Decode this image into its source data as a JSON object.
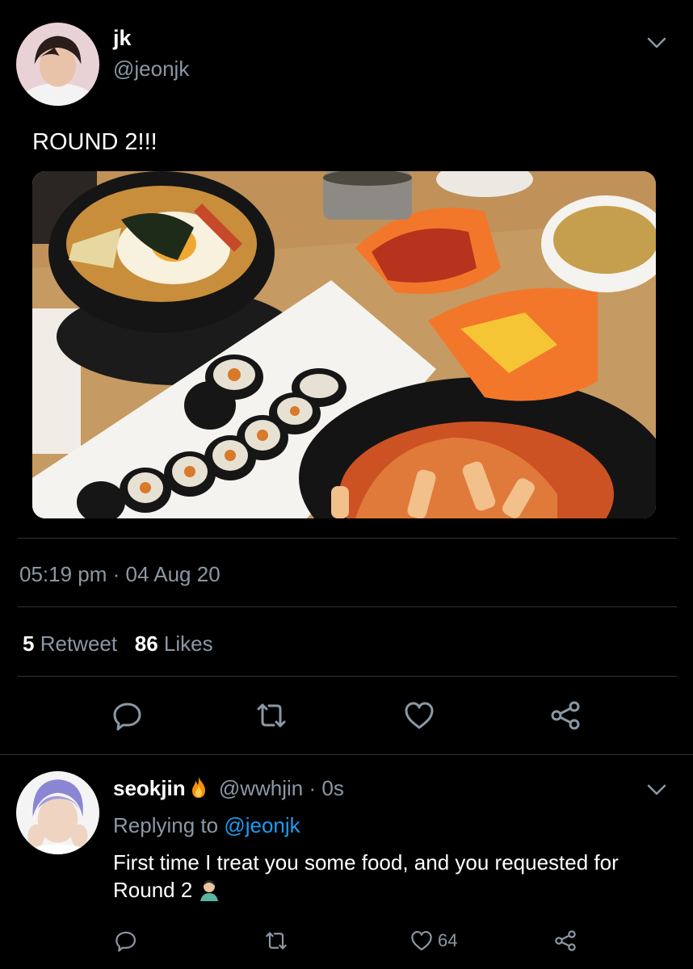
{
  "tweet": {
    "author_name": "jk",
    "author_handle": "@jeonjk",
    "text": "ROUND 2!!!",
    "time": "05:19 pm",
    "separator": "·",
    "date": "04 Aug 20",
    "retweet_count": "5",
    "retweet_label": "Retweet",
    "like_count": "86",
    "like_label": "Likes",
    "icons": [
      "chevron-down-icon",
      "reply-icon",
      "retweet-icon",
      "like-icon",
      "share-icon"
    ]
  },
  "reply": {
    "author_name": "seokjin",
    "emoji": "fire",
    "author_handle": "@wwhjin",
    "separator": "·",
    "age": "0s",
    "replying_prefix": "Replying to",
    "replying_mention": "@jeonjk",
    "text": "First time I treat you some food, and you requested for Round 2",
    "trailing_emoji": "man-facepalming",
    "like_count": "64"
  },
  "colors": {
    "background": "#000000",
    "text": "#ffffff",
    "secondary": "#8b98a5",
    "accent": "#1d9bf0",
    "divider": "#2f3336"
  }
}
